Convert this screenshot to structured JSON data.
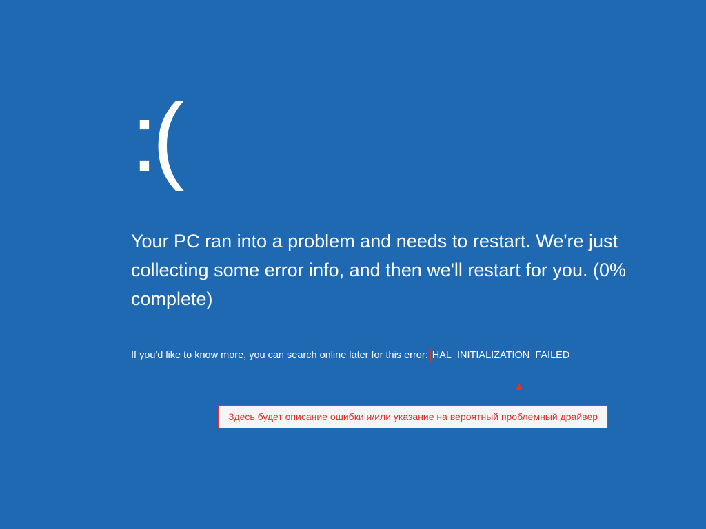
{
  "bsod": {
    "sad_face": ":(",
    "message_line1": "Your PC ran into a problem and needs to restart. We're just",
    "message_line2": "collecting some error info, and then we'll restart for you. (0%",
    "message_line3": "complete)",
    "detail_prefix": "If you'd like to know more, you can search online later for this error:",
    "error_code": "HAL_INITIALIZATION_FAILED"
  },
  "annotation": {
    "text": "Здесь будет описание ошибки и/или указание на вероятный проблемный драйвер"
  },
  "colors": {
    "background": "#1f69b3",
    "highlight": "#e03030",
    "annotation_bg": "#f5f5f5"
  }
}
